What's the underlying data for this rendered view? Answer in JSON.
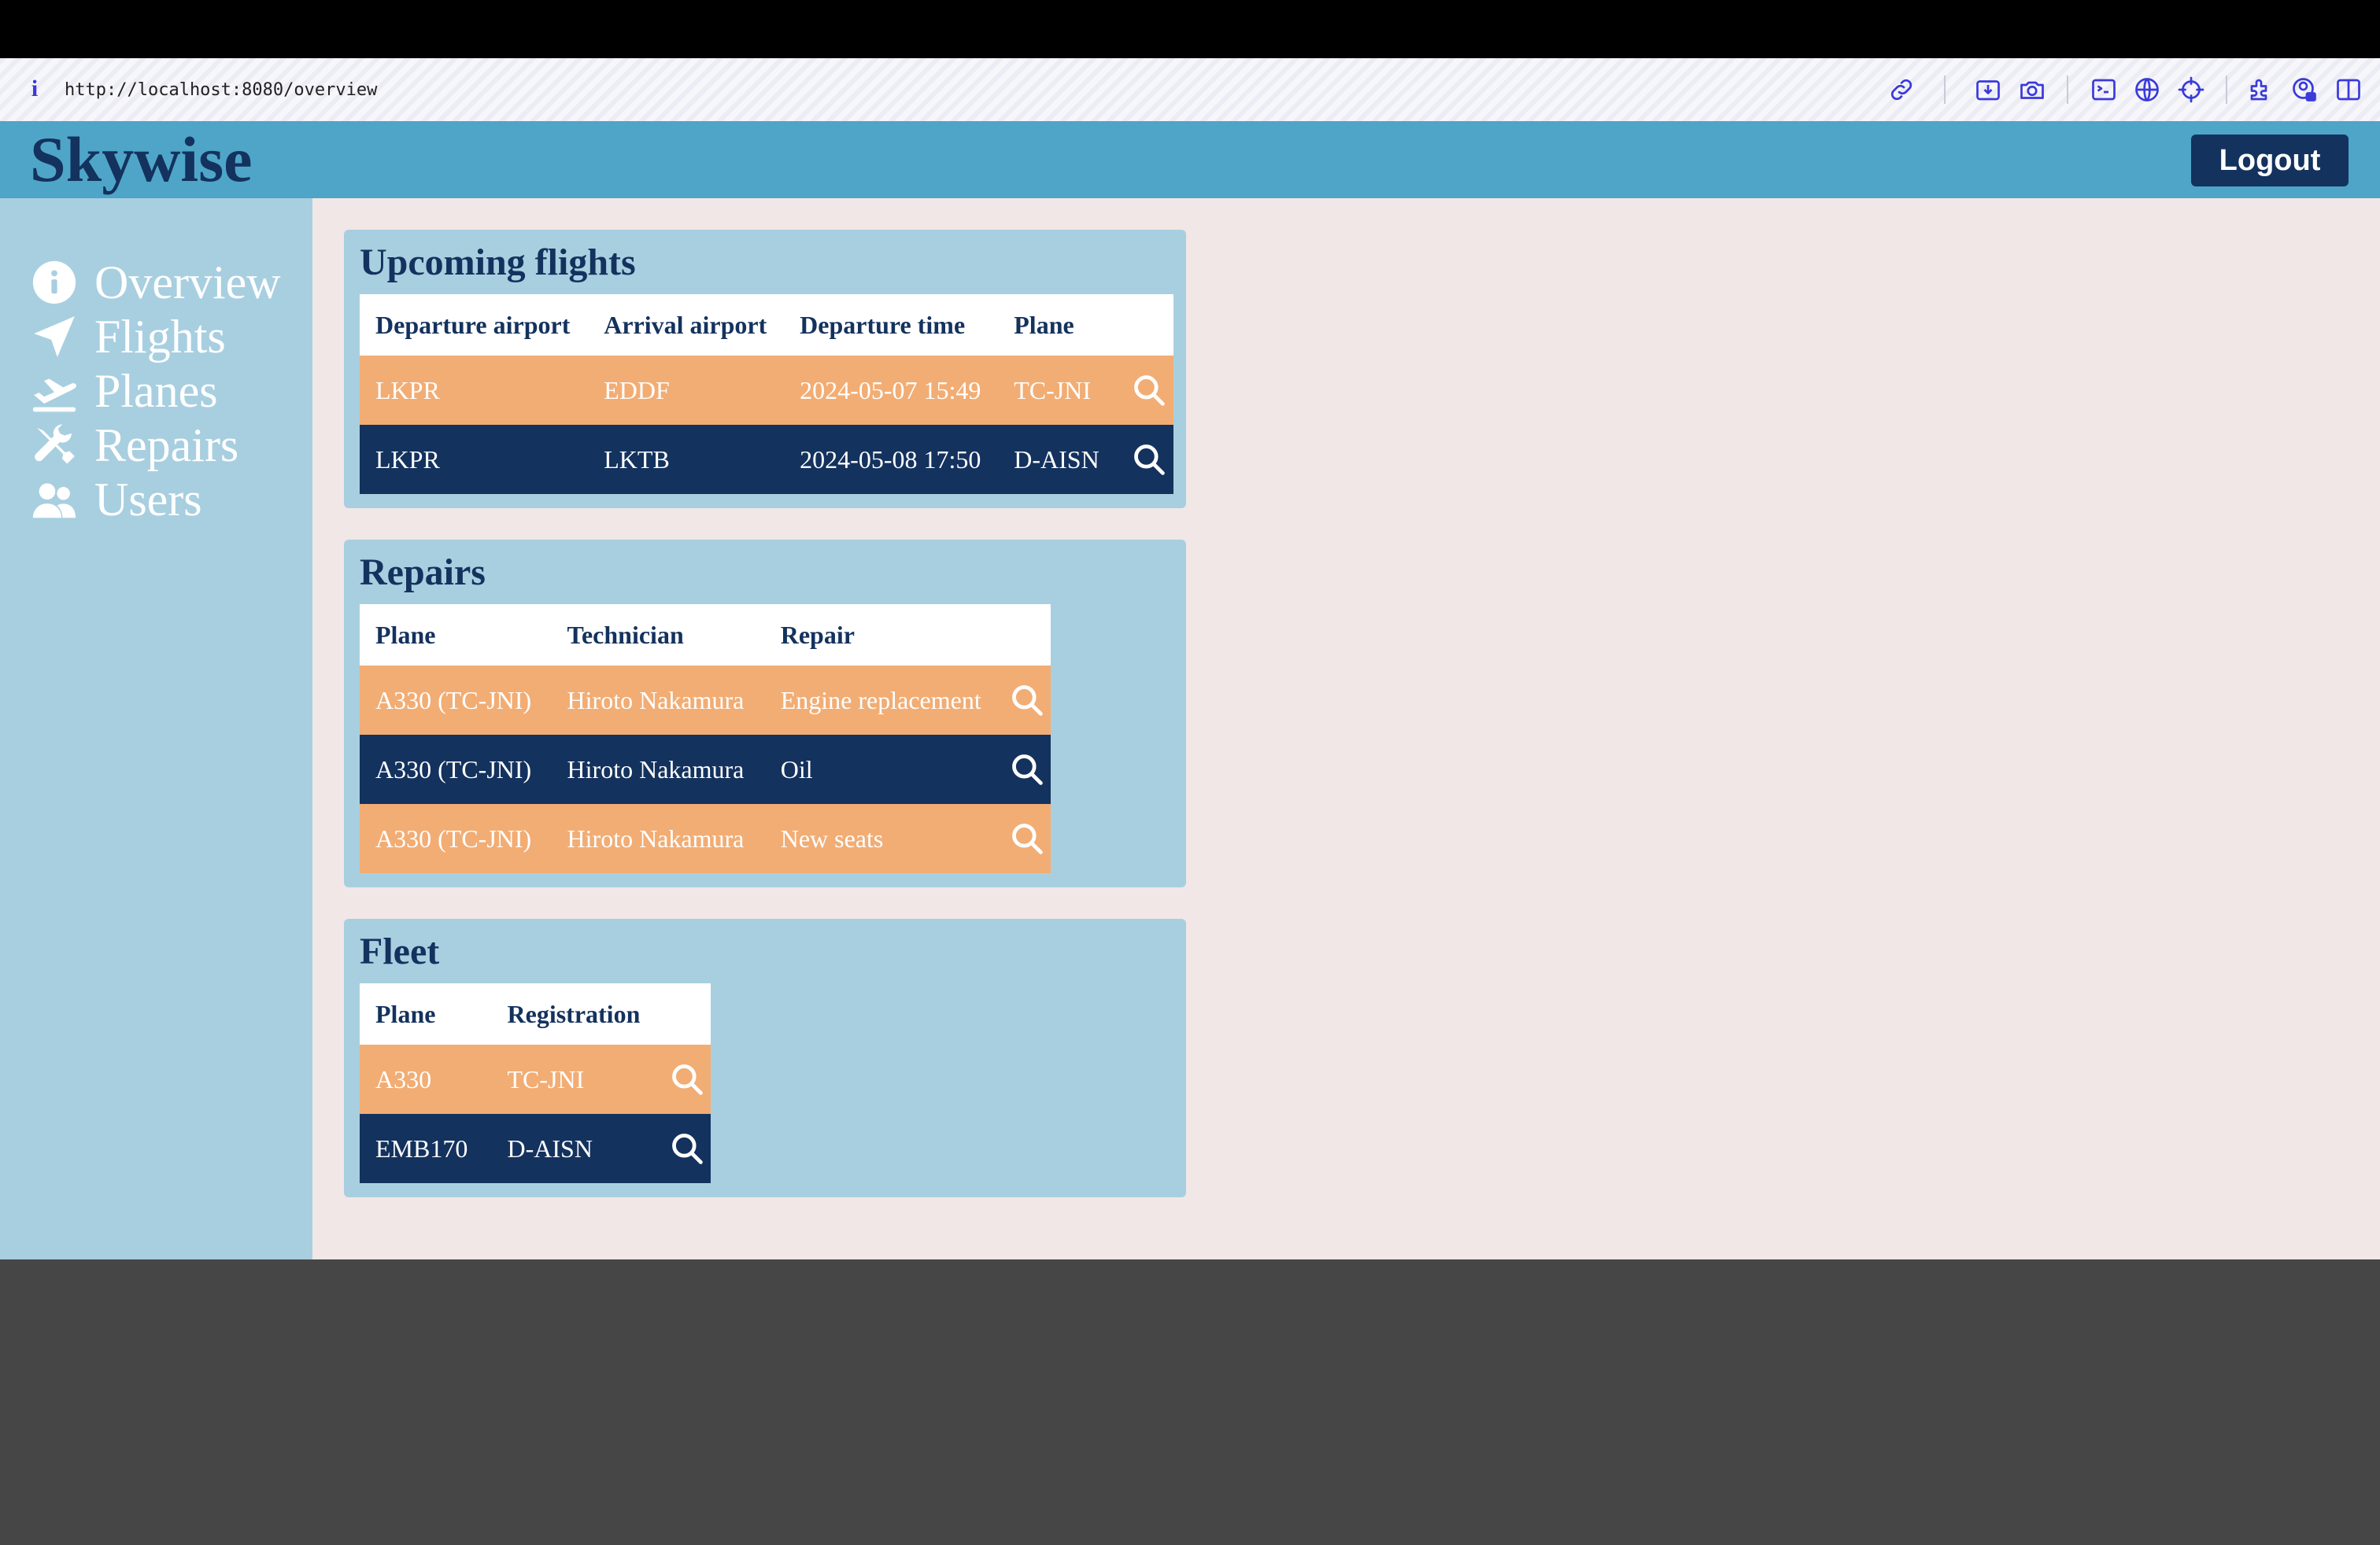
{
  "browser": {
    "url": "http://localhost:8080/overview",
    "toolbar_icons": [
      "link-icon",
      "download-icon",
      "camera-icon",
      "terminal-icon",
      "globe-icon",
      "crosshair-icon",
      "extensions-icon",
      "account-lock-icon",
      "sidebar-icon"
    ]
  },
  "app": {
    "title": "Skywise",
    "logout_label": "Logout"
  },
  "sidebar": {
    "items": [
      {
        "label": "Overview",
        "icon": "info-circle-icon"
      },
      {
        "label": "Flights",
        "icon": "location-arrow-icon"
      },
      {
        "label": "Planes",
        "icon": "plane-departure-icon"
      },
      {
        "label": "Repairs",
        "icon": "tools-icon"
      },
      {
        "label": "Users",
        "icon": "users-icon"
      }
    ]
  },
  "upcoming_flights": {
    "title": "Upcoming flights",
    "columns": [
      "Departure airport",
      "Arrival airport",
      "Departure time",
      "Plane"
    ],
    "rows": [
      {
        "departure": "LKPR",
        "arrival": "EDDF",
        "time": "2024-05-07 15:49",
        "plane": "TC-JNI"
      },
      {
        "departure": "LKPR",
        "arrival": "LKTB",
        "time": "2024-05-08 17:50",
        "plane": "D-AISN"
      }
    ]
  },
  "repairs": {
    "title": "Repairs",
    "columns": [
      "Plane",
      "Technician",
      "Repair"
    ],
    "rows": [
      {
        "plane": "A330 (TC-JNI)",
        "technician": "Hiroto Nakamura",
        "repair": "Engine replacement"
      },
      {
        "plane": "A330 (TC-JNI)",
        "technician": "Hiroto Nakamura",
        "repair": "Oil"
      },
      {
        "plane": "A330 (TC-JNI)",
        "technician": "Hiroto Nakamura",
        "repair": "New seats"
      }
    ]
  },
  "fleet": {
    "title": "Fleet",
    "columns": [
      "Plane",
      "Registration"
    ],
    "rows": [
      {
        "plane": "A330",
        "registration": "TC-JNI"
      },
      {
        "plane": "EMB170",
        "registration": "D-AISN"
      }
    ]
  },
  "colors": {
    "header": "#4ea5c8",
    "sidebar": "#a8cfe0",
    "navy": "#14325e",
    "orange_row": "#f2ad74",
    "main_bg": "#f1e7e6"
  }
}
